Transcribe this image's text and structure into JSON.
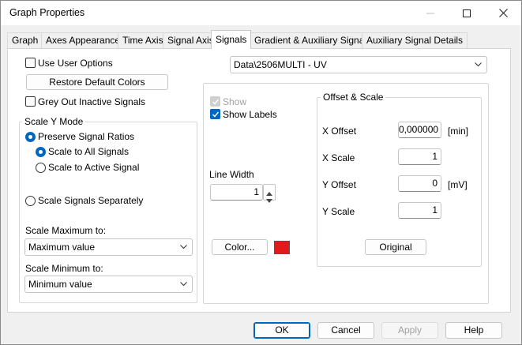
{
  "window": {
    "title": "Graph Properties"
  },
  "tabs": [
    {
      "label": "Graph"
    },
    {
      "label": "Axes Appearance"
    },
    {
      "label": "Time Axis"
    },
    {
      "label": "Signal Axis"
    },
    {
      "label": "Signals"
    },
    {
      "label": "Gradient & Auxiliary Signals"
    },
    {
      "label": "Auxiliary Signal Details"
    }
  ],
  "left": {
    "use_user_options": {
      "label": "Use User Options",
      "checked": false
    },
    "restore_colors_label": "Restore Default Colors",
    "grey_out": {
      "label": "Grey Out Inactive Signals",
      "checked": false
    },
    "scale_y_mode": {
      "title": "Scale Y Mode",
      "preserve": {
        "label": "Preserve Signal Ratios",
        "checked": true
      },
      "scale_all": {
        "label": "Scale to All Signals",
        "checked": true
      },
      "scale_active": {
        "label": "Scale to Active Signal",
        "checked": false
      },
      "separately": {
        "label": "Scale Signals Separately",
        "checked": false
      },
      "max_label": "Scale Maximum to:",
      "max_value": "Maximum value",
      "min_label": "Scale Minimum to:",
      "min_value": "Minimum value"
    }
  },
  "right": {
    "signal_select": "Data\\2506MULTI - UV",
    "show": {
      "label": "Show",
      "checked": true,
      "disabled": true
    },
    "show_labels": {
      "label": "Show Labels",
      "checked": true
    },
    "line_width_label": "Line Width",
    "line_width_value": "1",
    "color_button": "Color...",
    "color_value": "#e11b1b",
    "offset_scale": {
      "title": "Offset & Scale",
      "x_offset_label": "X Offset",
      "x_offset_value": "0,000000",
      "x_offset_unit": "[min]",
      "x_scale_label": "X Scale",
      "x_scale_value": "1",
      "y_offset_label": "Y Offset",
      "y_offset_value": "0",
      "y_offset_unit": "[mV]",
      "y_scale_label": "Y Scale",
      "y_scale_value": "1",
      "original_button": "Original"
    }
  },
  "footer": {
    "ok": "OK",
    "cancel": "Cancel",
    "apply": "Apply",
    "help": "Help"
  }
}
